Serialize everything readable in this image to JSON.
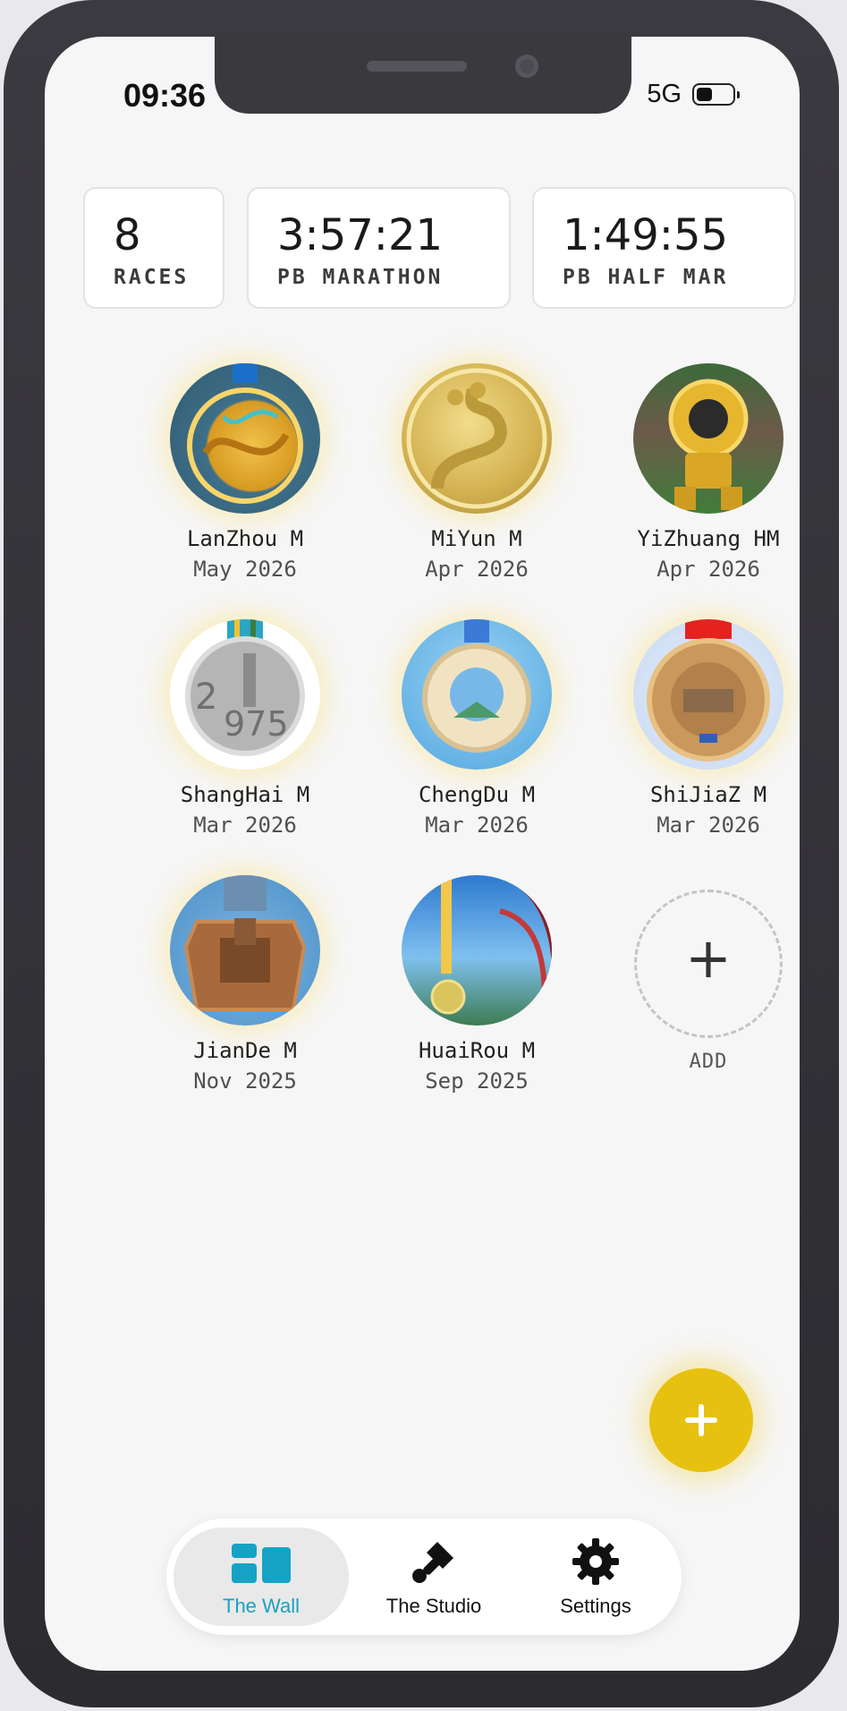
{
  "status_bar": {
    "time": "09:36",
    "network": "5G"
  },
  "stats": [
    {
      "value": "8",
      "label": "RACES"
    },
    {
      "value": "3:57:21",
      "label": "PB MARATHON"
    },
    {
      "value": "1:49:55",
      "label": "PB HALF MAR"
    }
  ],
  "medals": [
    {
      "name": "LanZhou M",
      "date": "May 2026"
    },
    {
      "name": "MiYun M",
      "date": "Apr 2026"
    },
    {
      "name": "YiZhuang HM",
      "date": "Apr 2026"
    },
    {
      "name": "ShangHai M",
      "date": "Mar 2026"
    },
    {
      "name": "ChengDu M",
      "date": "Mar 2026"
    },
    {
      "name": "ShiJiaZ M",
      "date": "Mar 2026"
    },
    {
      "name": "JianDe M",
      "date": "Nov 2025"
    },
    {
      "name": "HuaiRou M",
      "date": "Sep 2025"
    }
  ],
  "add_tile": {
    "label": "ADD"
  },
  "tabs": [
    {
      "label": "The Wall",
      "icon": "wall-icon",
      "active": true
    },
    {
      "label": "The Studio",
      "icon": "brush-icon",
      "active": false
    },
    {
      "label": "Settings",
      "icon": "gear-icon",
      "active": false
    }
  ],
  "colors": {
    "accent": "#16a2c4",
    "fab": "#e6c10f",
    "background": "#f6f6f6"
  }
}
